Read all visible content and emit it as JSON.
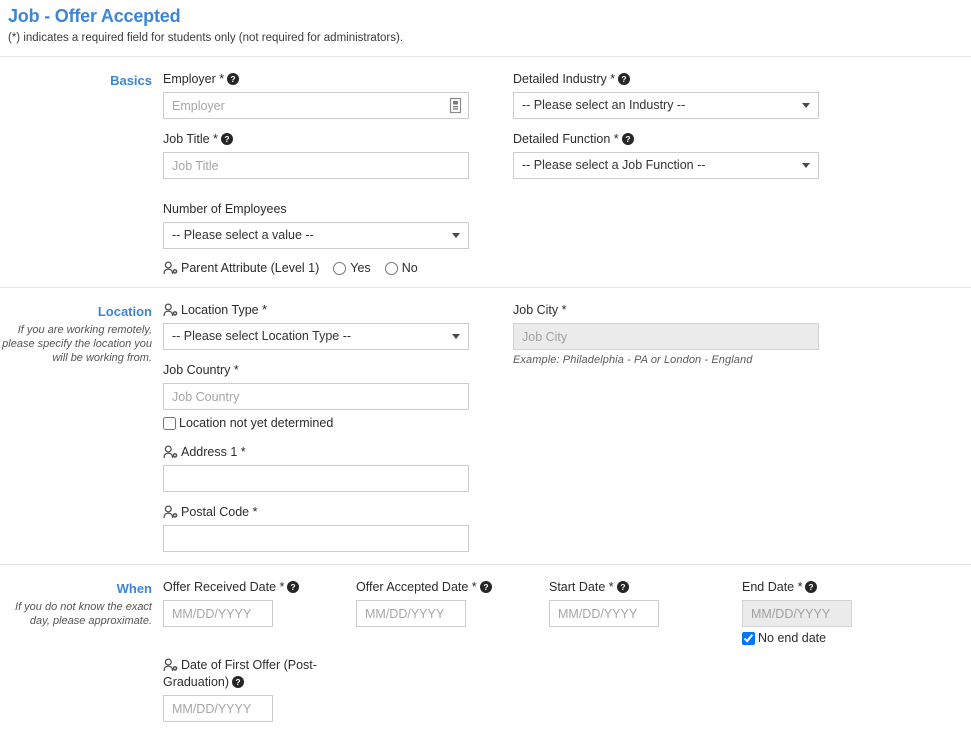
{
  "header": {
    "title": "Job - Offer Accepted",
    "subtitle": "(*) indicates a required field for students only (not required for administrators)."
  },
  "sections": {
    "basics": {
      "title": "Basics",
      "employer": {
        "label": "Employer *",
        "placeholder": "Employer",
        "value": "",
        "icon": "employer-lookup-icon",
        "help": "help-icon"
      },
      "job_title": {
        "label": "Job Title *",
        "placeholder": "Job Title",
        "value": ""
      },
      "number_of_employees": {
        "label": "Number of Employees",
        "selected": "-- Please select a value --"
      },
      "detailed_industry": {
        "label": "Detailed Industry *",
        "selected": "-- Please select an Industry --"
      },
      "detailed_function": {
        "label": "Detailed Function *",
        "selected": "-- Please select a Job Function --"
      },
      "parent_attribute": {
        "label": "Parent Attribute (Level 1)",
        "options": [
          "Yes",
          "No"
        ],
        "selected": ""
      }
    },
    "location": {
      "title": "Location",
      "hint": "If you are working remotely, please specify the location you will be working from.",
      "location_type": {
        "label": "Location Type *",
        "selected": "-- Please select Location Type --"
      },
      "job_country": {
        "label": "Job Country *",
        "placeholder": "Job Country",
        "value": ""
      },
      "not_determined": {
        "label": "Location not yet determined",
        "checked": false
      },
      "address1": {
        "label": "Address 1 *",
        "placeholder": "",
        "value": ""
      },
      "postal_code": {
        "label": "Postal Code *",
        "placeholder": "",
        "value": ""
      },
      "job_city": {
        "label": "Job City *",
        "placeholder": "Job City",
        "value": "",
        "disabled": true,
        "example": "Example: Philadelphia - PA  or  London - England"
      }
    },
    "when": {
      "title": "When",
      "hint": "If you do not know the exact day, please approximate.",
      "offer_received": {
        "label": "Offer Received Date *",
        "placeholder": "MM/DD/YYYY",
        "value": ""
      },
      "offer_accepted": {
        "label": "Offer Accepted Date *",
        "placeholder": "MM/DD/YYYY",
        "value": ""
      },
      "start_date": {
        "label": "Start Date *",
        "placeholder": "MM/DD/YYYY",
        "value": ""
      },
      "end_date": {
        "label": "End Date *",
        "placeholder": "MM/DD/YYYY",
        "value": "",
        "disabled": true
      },
      "no_end_date": {
        "label": "No end date",
        "checked": true
      },
      "first_offer": {
        "label": "Date of First Offer (Post-Graduation)",
        "placeholder": "MM/DD/YYYY",
        "value": ""
      }
    }
  },
  "colors": {
    "accent": "#3d85d8",
    "text": "#2c2c2c",
    "border": "#cccccc",
    "disabled_bg": "#ebebeb",
    "checkbox_checked": "#2a7fe8"
  }
}
